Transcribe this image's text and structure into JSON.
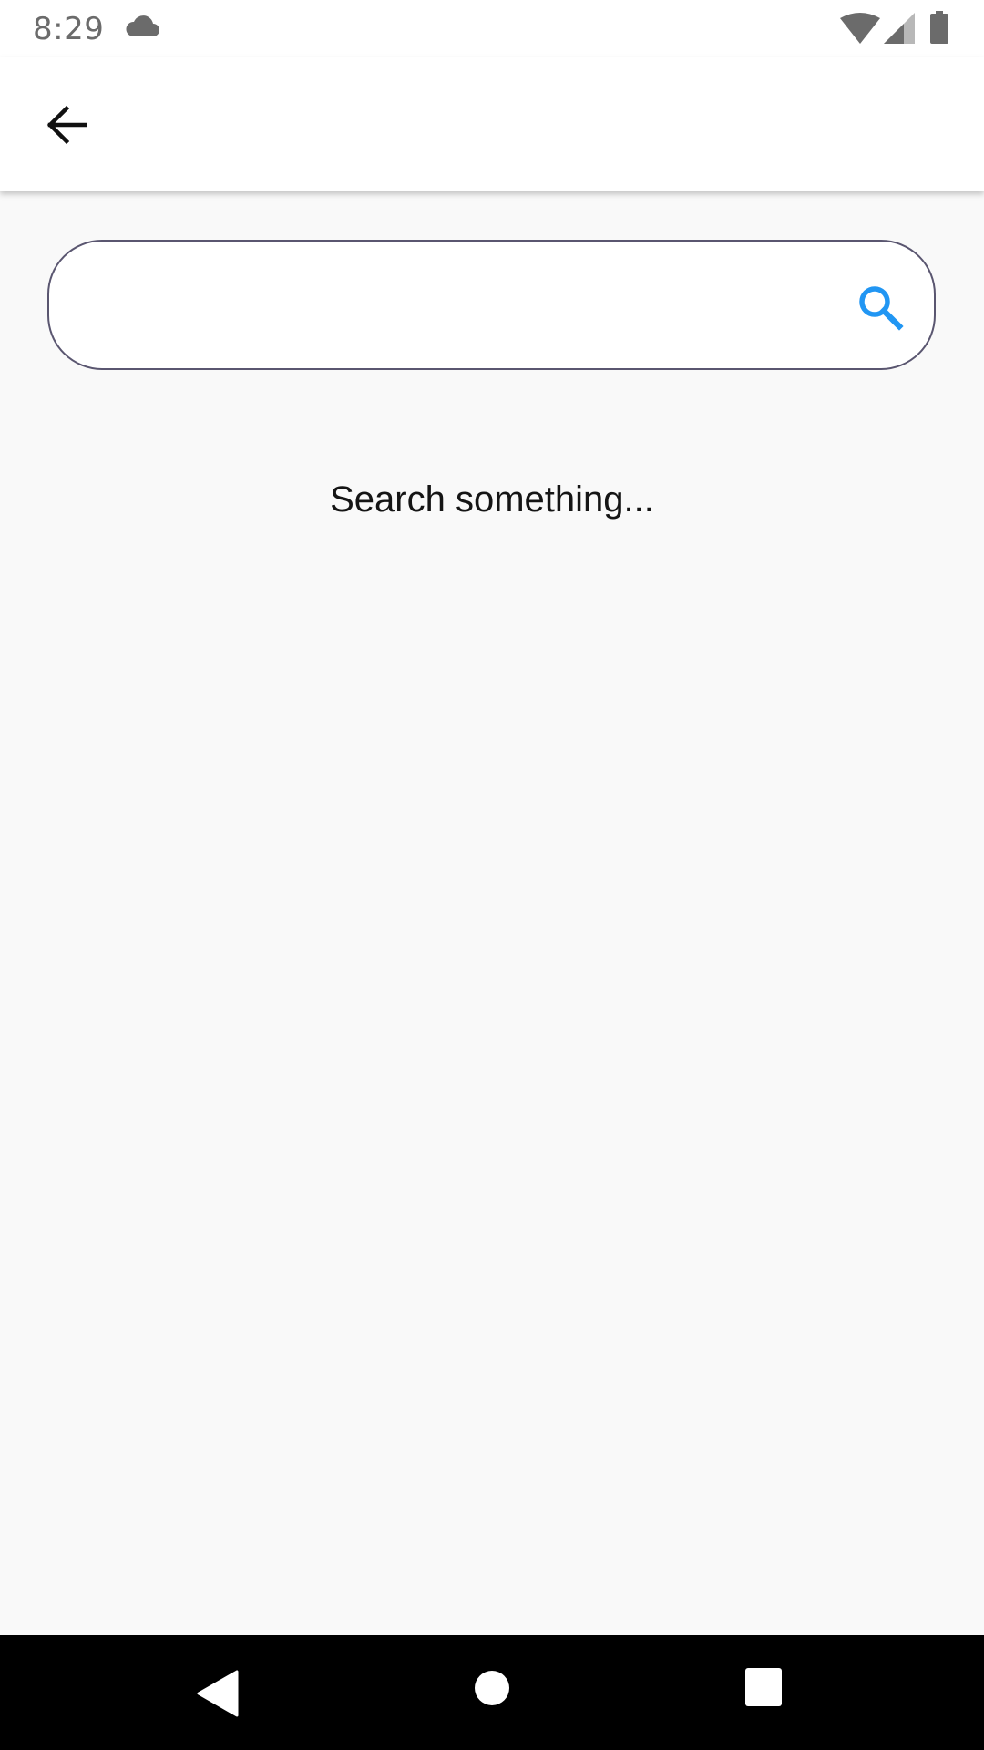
{
  "status_bar": {
    "time": "8:29",
    "icons": [
      "cloud-icon",
      "wifi-icon",
      "signal-icon",
      "battery-icon"
    ]
  },
  "app_bar": {
    "back_icon": "arrow-left-icon"
  },
  "search": {
    "value": "",
    "placeholder": "",
    "icon": "search-icon",
    "icon_color": "#2196F3",
    "border_color": "#5A5670"
  },
  "main": {
    "empty_message": "Search something..."
  },
  "nav_bar": {
    "icons": [
      "nav-back-icon",
      "nav-home-icon",
      "nav-recents-icon"
    ]
  }
}
